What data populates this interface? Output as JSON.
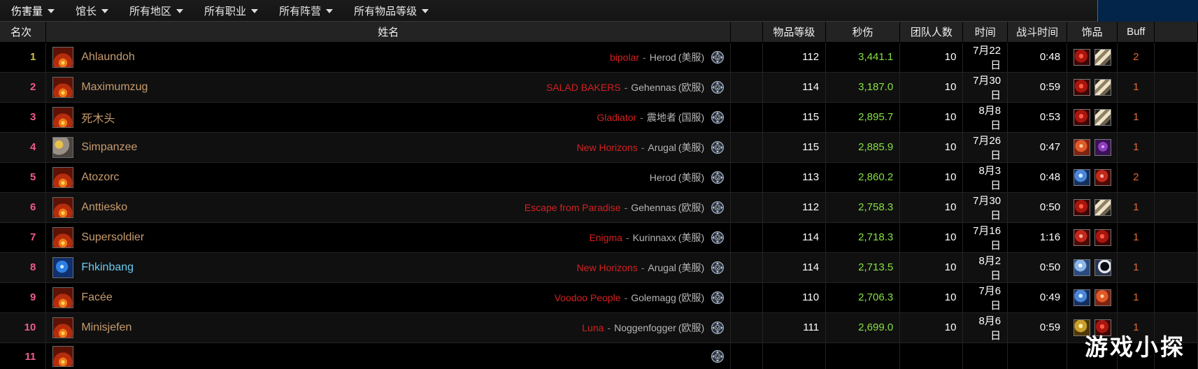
{
  "filters": [
    {
      "label": "伤害量",
      "name": "filter-metric"
    },
    {
      "label": "馆长",
      "name": "filter-boss"
    },
    {
      "label": "所有地区",
      "name": "filter-region"
    },
    {
      "label": "所有职业",
      "name": "filter-class"
    },
    {
      "label": "所有阵营",
      "name": "filter-faction"
    },
    {
      "label": "所有物品等级",
      "name": "filter-ilvl"
    }
  ],
  "columns": {
    "rank": "名次",
    "name": "姓名",
    "gap": "",
    "ilvl": "物品等级",
    "dps": "秒伤",
    "raid": "团队人数",
    "date": "时间",
    "fight": "战斗时间",
    "trinkets": "饰品",
    "buff": "Buff",
    "tail": ""
  },
  "colors": {
    "rank": "#f05a8c",
    "rank_first": "#cfc04a",
    "player_name": "#c79c6e",
    "player_name_mage": "#69ccf0",
    "guild": "#d42020",
    "realm": "#b6b6b6",
    "dps": "#86e03f",
    "buff": "#e06a33",
    "header_bg": "#232323",
    "blue_patch": "#022549"
  },
  "watermark": "游戏小探",
  "rows": [
    {
      "rank": "1",
      "name": "Ahlaundoh",
      "class": "warrior",
      "spec_icon": "warrior-fury-icon",
      "guild": "bipolar",
      "realm": "Herod",
      "region": "(美服)",
      "faction_icon": "wow-classic-icon",
      "ilvl": "112",
      "dps": "3,441.1",
      "raid": "10",
      "date": "7月22日",
      "fight": "0:48",
      "trinkets": [
        "trinket-red-heart-icon",
        "trinket-bone-icon"
      ],
      "buff": "2"
    },
    {
      "rank": "2",
      "name": "Maximumzug",
      "class": "warrior",
      "spec_icon": "warrior-fury-icon",
      "guild": "SALAD BAKERS",
      "realm": "Gehennas",
      "region": "(欧服)",
      "faction_icon": "wow-classic-icon",
      "ilvl": "114",
      "dps": "3,187.0",
      "raid": "10",
      "date": "7月30日",
      "fight": "0:59",
      "trinkets": [
        "trinket-red-heart-icon",
        "trinket-bone-icon"
      ],
      "buff": "1"
    },
    {
      "rank": "3",
      "name": "死木头",
      "class": "warrior",
      "spec_icon": "warrior-fury-icon",
      "guild": "Gladiator",
      "realm": "震地者",
      "region": "(国服)",
      "faction_icon": "wow-classic-icon",
      "ilvl": "115",
      "dps": "2,895.7",
      "raid": "10",
      "date": "8月8日",
      "fight": "0:53",
      "trinkets": [
        "trinket-red-heart-icon",
        "trinket-bone-icon"
      ],
      "buff": "1"
    },
    {
      "rank": "4",
      "name": "Simpanzee",
      "class": "hunter",
      "spec_icon": "hunter-beast-icon",
      "guild": "New Horizons",
      "realm": "Arugal",
      "region": "(美服)",
      "faction_icon": "wow-classic-icon",
      "ilvl": "115",
      "dps": "2,885.9",
      "raid": "10",
      "date": "7月26日",
      "fight": "0:47",
      "trinkets": [
        "trinket-orange-gem-icon",
        "trinket-purple-shell-icon"
      ],
      "buff": "1"
    },
    {
      "rank": "5",
      "name": "Atozorc",
      "class": "warrior",
      "spec_icon": "warrior-fury-icon",
      "guild": "",
      "realm": "Herod",
      "region": "(美服)",
      "faction_icon": "wow-classic-icon",
      "ilvl": "113",
      "dps": "2,860.2",
      "raid": "10",
      "date": "8月3日",
      "fight": "0:48",
      "trinkets": [
        "trinket-blue-gem-icon",
        "trinket-red-gem-icon"
      ],
      "buff": "2"
    },
    {
      "rank": "6",
      "name": "Anttiesko",
      "class": "warrior",
      "spec_icon": "warrior-fury-icon",
      "guild": "Escape from Paradise",
      "realm": "Gehennas",
      "region": "(欧服)",
      "faction_icon": "wow-classic-icon",
      "ilvl": "112",
      "dps": "2,758.3",
      "raid": "10",
      "date": "7月30日",
      "fight": "0:50",
      "trinkets": [
        "trinket-red-heart-icon",
        "trinket-bone-icon"
      ],
      "buff": "1"
    },
    {
      "rank": "7",
      "name": "Supersoldier",
      "class": "warrior",
      "spec_icon": "warrior-fury-icon",
      "guild": "Enigma",
      "realm": "Kurinnaxx",
      "region": "(美服)",
      "faction_icon": "wow-classic-icon",
      "ilvl": "114",
      "dps": "2,718.3",
      "raid": "10",
      "date": "7月16日",
      "fight": "1:16",
      "trinkets": [
        "trinket-red-gem-icon",
        "trinket-red-heart-icon"
      ],
      "buff": "1"
    },
    {
      "rank": "8",
      "name": "Fhkinbang",
      "class": "mage",
      "spec_icon": "mage-arcane-icon",
      "guild": "New Horizons",
      "realm": "Arugal",
      "region": "(美服)",
      "faction_icon": "wow-classic-icon",
      "ilvl": "114",
      "dps": "2,713.5",
      "raid": "10",
      "date": "8月2日",
      "fight": "0:50",
      "trinkets": [
        "trinket-blue-orb-icon",
        "trinket-moon-icon"
      ],
      "buff": "1"
    },
    {
      "rank": "9",
      "name": "Facée",
      "class": "warrior",
      "spec_icon": "warrior-fury-icon",
      "guild": "Voodoo People",
      "realm": "Golemagg",
      "region": "(欧服)",
      "faction_icon": "wow-classic-icon",
      "ilvl": "110",
      "dps": "2,706.3",
      "raid": "10",
      "date": "7月6日",
      "fight": "0:49",
      "trinkets": [
        "trinket-blue-gem-icon",
        "trinket-orange-gem-icon"
      ],
      "buff": "1"
    },
    {
      "rank": "10",
      "name": "Minisjefen",
      "class": "warrior",
      "spec_icon": "warrior-fury-icon",
      "guild": "Luna",
      "realm": "Noggenfogger",
      "region": "(欧服)",
      "faction_icon": "wow-classic-icon",
      "ilvl": "111",
      "dps": "2,699.0",
      "raid": "10",
      "date": "8月6日",
      "fight": "0:59",
      "trinkets": [
        "trinket-gold-icon",
        "trinket-red-heart-icon"
      ],
      "buff": "1"
    },
    {
      "rank": "11",
      "name": "",
      "class": "warrior",
      "spec_icon": "warrior-fury-icon",
      "guild": "",
      "realm": "",
      "region": "",
      "faction_icon": "wow-classic-icon",
      "ilvl": "",
      "dps": "",
      "raid": "",
      "date": "",
      "fight": "",
      "trinkets": [],
      "buff": ""
    }
  ]
}
